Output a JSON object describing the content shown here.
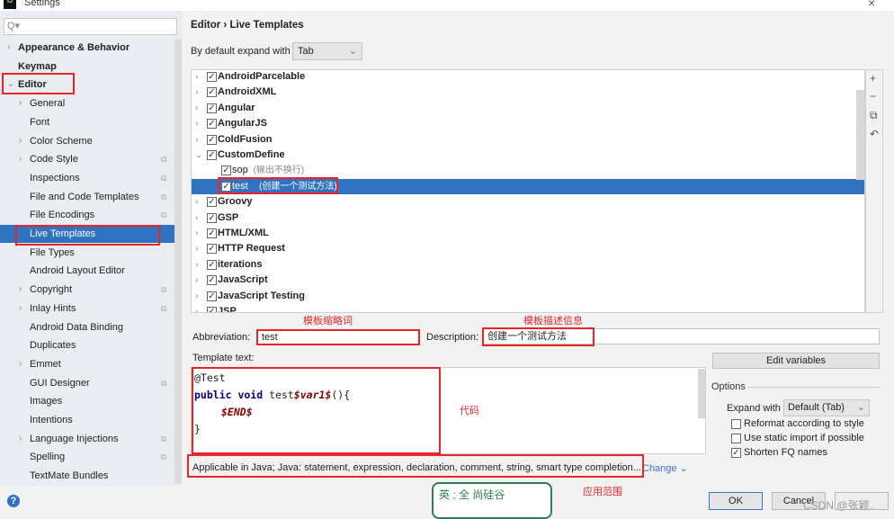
{
  "window": {
    "title": "Settings",
    "icon": "intellij-icon",
    "close": "×"
  },
  "sidebar": {
    "search_placeholder": "Q▾",
    "items": [
      {
        "label": "Appearance & Behavior",
        "bold": true,
        "level": 0,
        "arrow": "›"
      },
      {
        "label": "Keymap",
        "bold": true,
        "level": 0
      },
      {
        "label": "Editor",
        "bold": true,
        "level": 0,
        "arrow": "⌄"
      },
      {
        "label": "General",
        "level": 1,
        "arrow": "›"
      },
      {
        "label": "Font",
        "level": 1
      },
      {
        "label": "Color Scheme",
        "level": 1,
        "arrow": "›"
      },
      {
        "label": "Code Style",
        "level": 1,
        "arrow": "›",
        "copy": true
      },
      {
        "label": "Inspections",
        "level": 1,
        "copy": true
      },
      {
        "label": "File and Code Templates",
        "level": 1,
        "copy": true
      },
      {
        "label": "File Encodings",
        "level": 1,
        "copy": true
      },
      {
        "label": "Live Templates",
        "level": 1,
        "selected": true
      },
      {
        "label": "File Types",
        "level": 1
      },
      {
        "label": "Android Layout Editor",
        "level": 1
      },
      {
        "label": "Copyright",
        "level": 1,
        "arrow": "›",
        "copy": true
      },
      {
        "label": "Inlay Hints",
        "level": 1,
        "arrow": "›",
        "copy": true
      },
      {
        "label": "Android Data Binding",
        "level": 1
      },
      {
        "label": "Duplicates",
        "level": 1
      },
      {
        "label": "Emmet",
        "level": 1,
        "arrow": "›"
      },
      {
        "label": "GUI Designer",
        "level": 1,
        "copy": true
      },
      {
        "label": "Images",
        "level": 1
      },
      {
        "label": "Intentions",
        "level": 1
      },
      {
        "label": "Language Injections",
        "level": 1,
        "arrow": "›",
        "copy": true
      },
      {
        "label": "Spelling",
        "level": 1,
        "copy": true
      },
      {
        "label": "TextMate Bundles",
        "level": 1
      }
    ]
  },
  "main": {
    "breadcrumb": "Editor  ›  Live Templates",
    "expand_label": "By default expand with",
    "expand_value": "Tab",
    "tree": [
      {
        "label": "AndroidParcelable",
        "group": true
      },
      {
        "label": "AndroidXML",
        "group": true
      },
      {
        "label": "Angular",
        "group": true
      },
      {
        "label": "AngularJS",
        "group": true
      },
      {
        "label": "ColdFusion",
        "group": true
      },
      {
        "label": "CustomDefine",
        "group": true,
        "expanded": true
      },
      {
        "label": "sop",
        "desc": "(输出不换行)"
      },
      {
        "label": "test",
        "desc": "(创建一个测试方法)",
        "selected": true
      },
      {
        "label": "Groovy",
        "group": true
      },
      {
        "label": "GSP",
        "group": true
      },
      {
        "label": "HTML/XML",
        "group": true
      },
      {
        "label": "HTTP Request",
        "group": true
      },
      {
        "label": "iterations",
        "group": true
      },
      {
        "label": "JavaScript",
        "group": true
      },
      {
        "label": "JavaScript Testing",
        "group": true
      },
      {
        "label": "JSP",
        "group": true
      }
    ],
    "tools": [
      "+",
      "−",
      "⧉",
      "↶"
    ],
    "abbreviation_label": "Abbreviation:",
    "abbreviation_value": "test",
    "description_label": "Description:",
    "description_value": "创建一个测试方法",
    "template_text_label": "Template text:",
    "code": {
      "l1": "@Test",
      "kw": "public void",
      "name": " test",
      "v1": "$var1$",
      "rest": "(){",
      "end": "$END$",
      "close": "}"
    },
    "edit_variables": "Edit variables",
    "options_label": "Options",
    "expand_with_label": "Expand with",
    "expand_with_value": "Default (Tab)",
    "options": [
      {
        "label": "Reformat according to style",
        "checked": false
      },
      {
        "label": "Use static import if possible",
        "checked": false
      },
      {
        "label": "Shorten FQ names",
        "checked": true
      }
    ],
    "applicable": "Applicable in Java; Java: statement, expression, declaration, comment, string, smart type completion...",
    "change": "Change ⌄"
  },
  "annotations": {
    "abbr": "模板缩略词",
    "desc": "模板描述信息",
    "code": "代码",
    "scope": "应用范围"
  },
  "footer": {
    "ok": "OK",
    "cancel": "Cancel",
    "help": "?",
    "watermark": "CSDN @张颖..",
    "ime": "英 ; 全 尚硅谷"
  },
  "colors": {
    "selection": "#2f73c1",
    "annotation": "#e8262a"
  }
}
